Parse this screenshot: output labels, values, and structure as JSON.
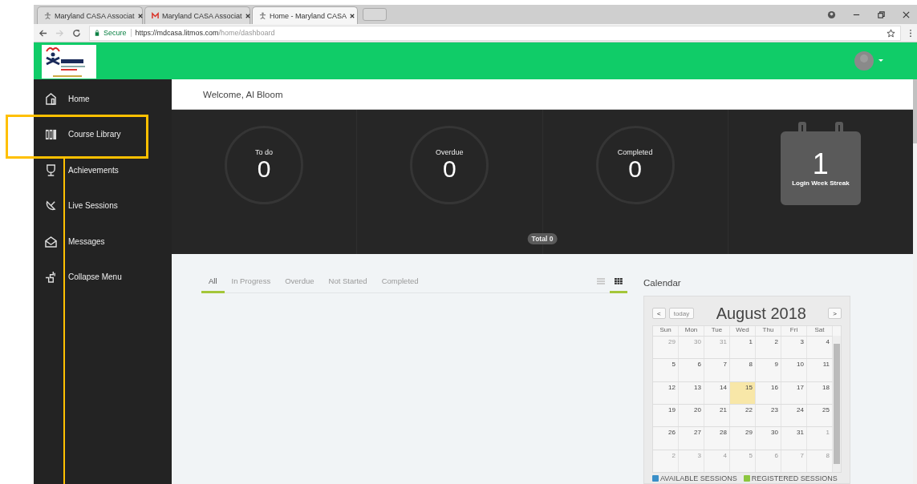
{
  "browser": {
    "tabs": [
      {
        "title": "Maryland CASA Associat",
        "kind": "casa",
        "selected": false
      },
      {
        "title": "Maryland CASA Associat",
        "kind": "mail",
        "selected": false
      },
      {
        "title": "Home - Maryland CASA",
        "kind": "casa",
        "selected": true
      }
    ],
    "secure": "Secure",
    "url_host": "https://mdcasa.litmos.com",
    "url_path": "/home/dashboard"
  },
  "sidebar": {
    "items": [
      {
        "label": "Home",
        "kind": "home",
        "highlighted": false
      },
      {
        "label": "Course Library",
        "kind": "library",
        "highlighted": true
      },
      {
        "label": "Achievements",
        "kind": "trophy",
        "highlighted": false
      },
      {
        "label": "Live Sessions",
        "kind": "dish",
        "highlighted": false
      },
      {
        "label": "Messages",
        "kind": "mail",
        "highlighted": false
      },
      {
        "label": "Collapse Menu",
        "kind": "puzzle",
        "highlighted": false
      }
    ]
  },
  "welcome": "Welcome, Al Bloom",
  "stats": [
    {
      "label": "To do",
      "value": "0"
    },
    {
      "label": "Overdue",
      "value": "0"
    },
    {
      "label": "Completed",
      "value": "0"
    }
  ],
  "streak": {
    "value": "1",
    "label": "Login Week Streak"
  },
  "total": "Total 0",
  "filters": [
    {
      "label": "All",
      "selected": true
    },
    {
      "label": "In Progress",
      "selected": false
    },
    {
      "label": "Overdue",
      "selected": false
    },
    {
      "label": "Not Started",
      "selected": false
    },
    {
      "label": "Completed",
      "selected": false
    }
  ],
  "views": [
    {
      "kind": "list",
      "selected": false
    },
    {
      "kind": "grid",
      "selected": true
    }
  ],
  "calendar": {
    "title": "Calendar",
    "today_button": "today",
    "prev": "<",
    "next": ">",
    "month": "August 2018",
    "weekdays": [
      "Sun",
      "Mon",
      "Tue",
      "Wed",
      "Thu",
      "Fri",
      "Sat"
    ],
    "weeks": [
      [
        {
          "day": "29",
          "muted": true,
          "today": false
        },
        {
          "day": "30",
          "muted": true,
          "today": false
        },
        {
          "day": "31",
          "muted": true,
          "today": false
        },
        {
          "day": "1",
          "muted": false,
          "today": false
        },
        {
          "day": "2",
          "muted": false,
          "today": false
        },
        {
          "day": "3",
          "muted": false,
          "today": false
        },
        {
          "day": "4",
          "muted": false,
          "today": false
        }
      ],
      [
        {
          "day": "5",
          "muted": false,
          "today": false
        },
        {
          "day": "6",
          "muted": false,
          "today": false
        },
        {
          "day": "7",
          "muted": false,
          "today": false
        },
        {
          "day": "8",
          "muted": false,
          "today": false
        },
        {
          "day": "9",
          "muted": false,
          "today": false
        },
        {
          "day": "10",
          "muted": false,
          "today": false
        },
        {
          "day": "11",
          "muted": false,
          "today": false
        }
      ],
      [
        {
          "day": "12",
          "muted": false,
          "today": false
        },
        {
          "day": "13",
          "muted": false,
          "today": false
        },
        {
          "day": "14",
          "muted": false,
          "today": false
        },
        {
          "day": "15",
          "muted": false,
          "today": true
        },
        {
          "day": "16",
          "muted": false,
          "today": false
        },
        {
          "day": "17",
          "muted": false,
          "today": false
        },
        {
          "day": "18",
          "muted": false,
          "today": false
        }
      ],
      [
        {
          "day": "19",
          "muted": false,
          "today": false
        },
        {
          "day": "20",
          "muted": false,
          "today": false
        },
        {
          "day": "21",
          "muted": false,
          "today": false
        },
        {
          "day": "22",
          "muted": false,
          "today": false
        },
        {
          "day": "23",
          "muted": false,
          "today": false
        },
        {
          "day": "24",
          "muted": false,
          "today": false
        },
        {
          "day": "25",
          "muted": false,
          "today": false
        }
      ],
      [
        {
          "day": "26",
          "muted": false,
          "today": false
        },
        {
          "day": "27",
          "muted": false,
          "today": false
        },
        {
          "day": "28",
          "muted": false,
          "today": false
        },
        {
          "day": "29",
          "muted": false,
          "today": false
        },
        {
          "day": "30",
          "muted": false,
          "today": false
        },
        {
          "day": "31",
          "muted": false,
          "today": false
        },
        {
          "day": "1",
          "muted": true,
          "today": false
        }
      ],
      [
        {
          "day": "2",
          "muted": true,
          "today": false
        },
        {
          "day": "3",
          "muted": true,
          "today": false
        },
        {
          "day": "4",
          "muted": true,
          "today": false
        },
        {
          "day": "5",
          "muted": true,
          "today": false
        },
        {
          "day": "6",
          "muted": true,
          "today": false
        },
        {
          "day": "7",
          "muted": true,
          "today": false
        },
        {
          "day": "8",
          "muted": true,
          "today": false
        }
      ]
    ],
    "legend": [
      {
        "label": "AVAILABLE SESSIONS",
        "color": "#3a8fc8"
      },
      {
        "label": "REGISTERED SESSIONS",
        "color": "#8cc63f"
      }
    ]
  }
}
